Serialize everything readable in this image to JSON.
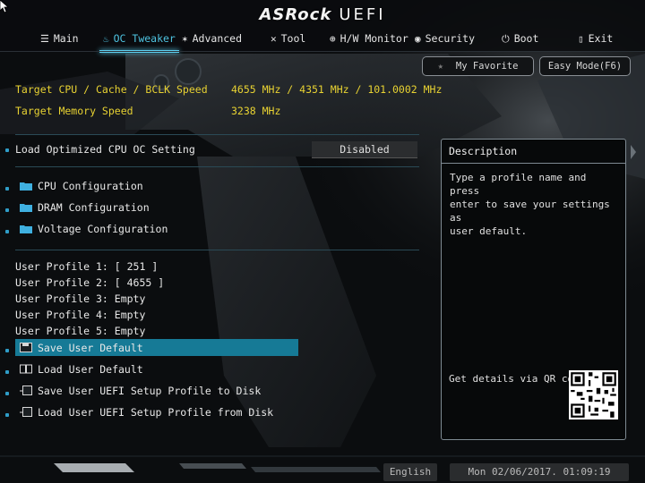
{
  "header": {
    "logo_brand": "ASRock",
    "logo_suffix": "UEFI",
    "tabs": [
      {
        "label": "Main",
        "icon": "list-icon",
        "active": false
      },
      {
        "label": "OC Tweaker",
        "icon": "flame-icon",
        "active": true
      },
      {
        "label": "Advanced",
        "icon": "star-icon",
        "active": false
      },
      {
        "label": "Tool",
        "icon": "wrench-icon",
        "active": false
      },
      {
        "label": "H/W Monitor",
        "icon": "monitor-icon",
        "active": false
      },
      {
        "label": "Security",
        "icon": "shield-icon",
        "active": false
      },
      {
        "label": "Boot",
        "icon": "power-icon",
        "active": false
      },
      {
        "label": "Exit",
        "icon": "exit-door-icon",
        "active": false
      }
    ]
  },
  "buttons": {
    "my_favorite": "My Favorite",
    "easy_mode": "Easy Mode(F6)"
  },
  "targets": {
    "cpu_label": "Target CPU / Cache / BCLK Speed",
    "cpu_value": "4655 MHz / 4351 MHz / 101.0002 MHz",
    "mem_label": "Target Memory Speed",
    "mem_value": "3238 MHz"
  },
  "load_optimized": {
    "label": "Load Optimized CPU OC Setting",
    "value": "Disabled"
  },
  "submenus": [
    "CPU Configuration",
    "DRAM Configuration",
    "Voltage Configuration"
  ],
  "profiles": [
    "User Profile 1: [ 251 ]",
    "User Profile 2: [ 4655 ]",
    "User Profile 3: Empty",
    "User Profile 4: Empty",
    "User Profile 5: Empty"
  ],
  "actions": [
    "Save User Default",
    "Load User Default",
    "Save User UEFI Setup Profile to Disk",
    "Load User UEFI Setup Profile from Disk"
  ],
  "description": {
    "title": "Description",
    "text": "Type a profile name and press\nenter to save your settings as\nuser default.",
    "qr_label": "Get details via QR code"
  },
  "footer": {
    "language": "English",
    "datetime": "Mon 02/06/2017. 01:09:19"
  },
  "colors": {
    "accent": "#4ec3e0",
    "highlight": "#167a96",
    "target_text": "#e8d232"
  }
}
